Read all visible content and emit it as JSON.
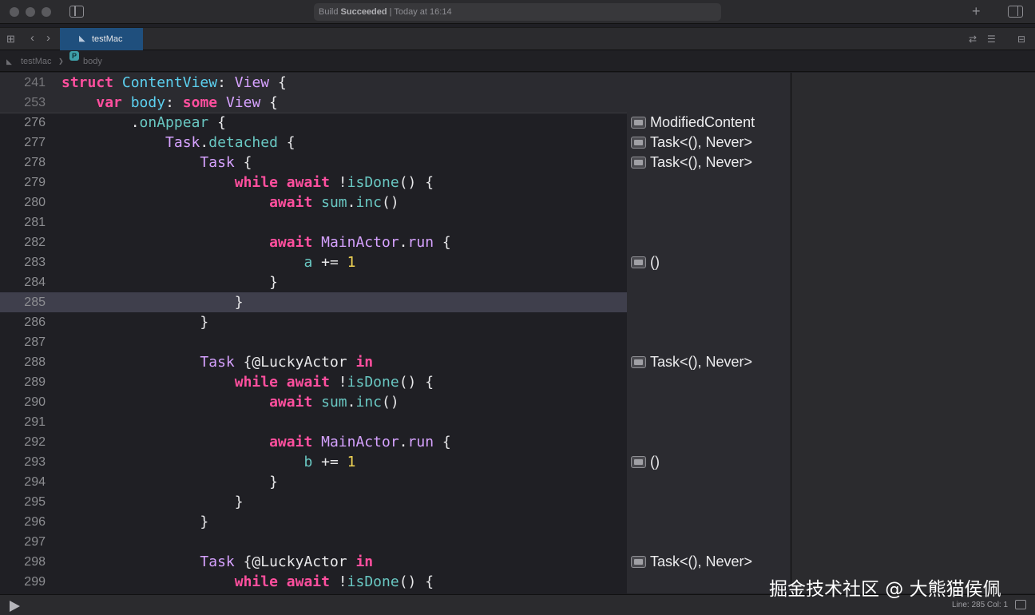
{
  "window": {
    "status": {
      "prefix": "Build ",
      "bold": "Succeeded",
      "suffix": " | Today at 16:14"
    },
    "tab_label": "testMac"
  },
  "breadcrumb": {
    "project": "testMac",
    "separator": "❯",
    "badge": "P",
    "symbol": "body"
  },
  "sticky_lines": [
    {
      "num": "241",
      "tokens": [
        [
          "kw",
          "struct"
        ],
        [
          "txt",
          " "
        ],
        [
          "decl",
          "ContentView"
        ],
        [
          "txt",
          ": "
        ],
        [
          "ty",
          "View"
        ],
        [
          "txt",
          " {"
        ]
      ]
    },
    {
      "num": "253",
      "tokens": [
        [
          "txt",
          "    "
        ],
        [
          "kw",
          "var"
        ],
        [
          "txt",
          " "
        ],
        [
          "decl",
          "body"
        ],
        [
          "txt",
          ": "
        ],
        [
          "kw",
          "some"
        ],
        [
          "txt",
          " "
        ],
        [
          "ty",
          "View"
        ],
        [
          "txt",
          " {"
        ]
      ]
    }
  ],
  "code_lines": [
    {
      "num": "276",
      "tokens": [
        [
          "txt",
          "        ."
        ],
        [
          "fn",
          "onAppear"
        ],
        [
          "txt",
          " {"
        ]
      ]
    },
    {
      "num": "277",
      "tokens": [
        [
          "txt",
          "            "
        ],
        [
          "ty",
          "Task"
        ],
        [
          "txt",
          "."
        ],
        [
          "fn",
          "detached"
        ],
        [
          "txt",
          " {"
        ]
      ]
    },
    {
      "num": "278",
      "tokens": [
        [
          "txt",
          "                "
        ],
        [
          "ty",
          "Task"
        ],
        [
          "txt",
          " {"
        ]
      ]
    },
    {
      "num": "279",
      "tokens": [
        [
          "txt",
          "                    "
        ],
        [
          "kw",
          "while"
        ],
        [
          "txt",
          " "
        ],
        [
          "kw",
          "await"
        ],
        [
          "txt",
          " !"
        ],
        [
          "fn",
          "isDone"
        ],
        [
          "txt",
          "() {"
        ]
      ]
    },
    {
      "num": "280",
      "tokens": [
        [
          "txt",
          "                        "
        ],
        [
          "kw",
          "await"
        ],
        [
          "txt",
          " "
        ],
        [
          "fn",
          "sum"
        ],
        [
          "txt",
          "."
        ],
        [
          "fn",
          "inc"
        ],
        [
          "txt",
          "()"
        ]
      ]
    },
    {
      "num": "281",
      "tokens": []
    },
    {
      "num": "282",
      "tokens": [
        [
          "txt",
          "                        "
        ],
        [
          "kw",
          "await"
        ],
        [
          "txt",
          " "
        ],
        [
          "ty",
          "MainActor"
        ],
        [
          "txt",
          "."
        ],
        [
          "ty",
          "run"
        ],
        [
          "txt",
          " {"
        ]
      ]
    },
    {
      "num": "283",
      "tokens": [
        [
          "txt",
          "                            "
        ],
        [
          "fn",
          "a"
        ],
        [
          "txt",
          " += "
        ],
        [
          "num",
          "1"
        ]
      ]
    },
    {
      "num": "284",
      "tokens": [
        [
          "txt",
          "                        }"
        ]
      ]
    },
    {
      "num": "285",
      "tokens": [
        [
          "txt",
          "                    }"
        ]
      ],
      "highlight": true
    },
    {
      "num": "286",
      "tokens": [
        [
          "txt",
          "                }"
        ]
      ]
    },
    {
      "num": "287",
      "tokens": []
    },
    {
      "num": "288",
      "tokens": [
        [
          "txt",
          "                "
        ],
        [
          "ty",
          "Task"
        ],
        [
          "txt",
          " {@LuckyActor "
        ],
        [
          "kw",
          "in"
        ]
      ]
    },
    {
      "num": "289",
      "tokens": [
        [
          "txt",
          "                    "
        ],
        [
          "kw",
          "while"
        ],
        [
          "txt",
          " "
        ],
        [
          "kw",
          "await"
        ],
        [
          "txt",
          " !"
        ],
        [
          "fn",
          "isDone"
        ],
        [
          "txt",
          "() {"
        ]
      ]
    },
    {
      "num": "290",
      "tokens": [
        [
          "txt",
          "                        "
        ],
        [
          "kw",
          "await"
        ],
        [
          "txt",
          " "
        ],
        [
          "fn",
          "sum"
        ],
        [
          "txt",
          "."
        ],
        [
          "fn",
          "inc"
        ],
        [
          "txt",
          "()"
        ]
      ]
    },
    {
      "num": "291",
      "tokens": []
    },
    {
      "num": "292",
      "tokens": [
        [
          "txt",
          "                        "
        ],
        [
          "kw",
          "await"
        ],
        [
          "txt",
          " "
        ],
        [
          "ty",
          "MainActor"
        ],
        [
          "txt",
          "."
        ],
        [
          "ty",
          "run"
        ],
        [
          "txt",
          " {"
        ]
      ]
    },
    {
      "num": "293",
      "tokens": [
        [
          "txt",
          "                            "
        ],
        [
          "fn",
          "b"
        ],
        [
          "txt",
          " += "
        ],
        [
          "num",
          "1"
        ]
      ]
    },
    {
      "num": "294",
      "tokens": [
        [
          "txt",
          "                        }"
        ]
      ]
    },
    {
      "num": "295",
      "tokens": [
        [
          "txt",
          "                    }"
        ]
      ]
    },
    {
      "num": "296",
      "tokens": [
        [
          "txt",
          "                }"
        ]
      ]
    },
    {
      "num": "297",
      "tokens": []
    },
    {
      "num": "298",
      "tokens": [
        [
          "txt",
          "                "
        ],
        [
          "ty",
          "Task"
        ],
        [
          "txt",
          " {@LuckyActor "
        ],
        [
          "kw",
          "in"
        ]
      ]
    },
    {
      "num": "299",
      "tokens": [
        [
          "txt",
          "                    "
        ],
        [
          "kw",
          "while"
        ],
        [
          "txt",
          " "
        ],
        [
          "kw",
          "await"
        ],
        [
          "txt",
          " !"
        ],
        [
          "fn",
          "isDone"
        ],
        [
          "txt",
          "() {"
        ]
      ]
    }
  ],
  "results": [
    {
      "line": "276",
      "text": "ModifiedContent"
    },
    {
      "line": "277",
      "text": "Task<(), Never>"
    },
    {
      "line": "278",
      "text": "Task<(), Never>"
    },
    {
      "line": "283",
      "text": "()"
    },
    {
      "line": "288",
      "text": "Task<(), Never>"
    },
    {
      "line": "293",
      "text": "()"
    },
    {
      "line": "298",
      "text": "Task<(), Never>"
    }
  ],
  "statusbar": {
    "position": "Line: 285  Col: 1"
  },
  "watermark": "掘金技术社区 @ 大熊猫侯佩",
  "colors": {
    "keyword": "#ff4f9e",
    "type": "#d6a2ff",
    "function": "#69c7c2",
    "declaration": "#5cd0ef",
    "number": "#f0d454",
    "current_line": "#3f3f4c",
    "tab": "#1f4f7d"
  },
  "icons": [
    "sidebar-toggle-icon",
    "add-icon",
    "inspector-toggle-icon",
    "grid-icon",
    "back-icon",
    "forward-icon",
    "swift-icon",
    "refresh-icon",
    "editor-options-icon",
    "split-editor-icon",
    "play-icon",
    "result-preview-icon"
  ]
}
